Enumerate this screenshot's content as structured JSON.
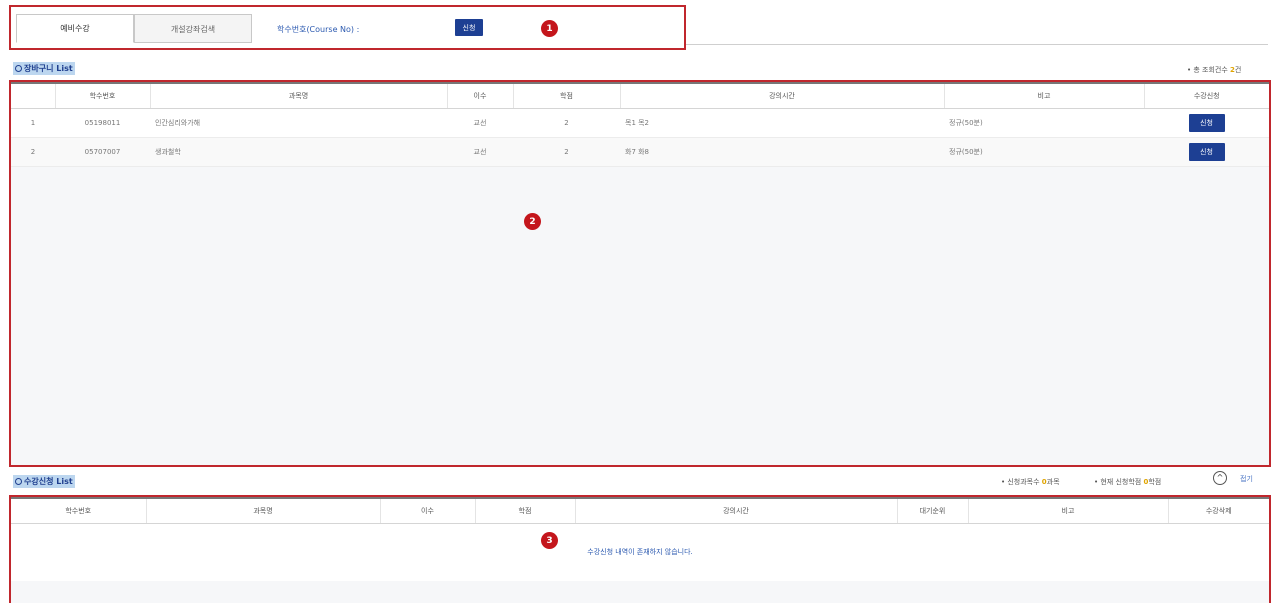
{
  "tabs": [
    {
      "label": "예비수강"
    },
    {
      "label": "개설강좌검색"
    }
  ],
  "search": {
    "course_no_label": "학수번호(Course No) :",
    "apply_button": "신청"
  },
  "markers": [
    "1",
    "2",
    "3"
  ],
  "cart": {
    "title": "장바구니 List",
    "count_prefix": "• 총 조회건수",
    "count_value": "2",
    "count_suffix": "건",
    "columns": [
      "학수번호",
      "과목명",
      "이수",
      "학점",
      "강의시간",
      "비고",
      "수강신청"
    ],
    "rows": [
      {
        "no": "1",
        "course_no": "05198011",
        "name": "인간심리와가해",
        "type": "교선",
        "credit": "2",
        "time": "목1 목2",
        "note": "정규(50분)",
        "action": "신청"
      },
      {
        "no": "2",
        "course_no": "05707007",
        "name": "생과철학",
        "type": "교선",
        "credit": "2",
        "time": "화7 화8",
        "note": "정규(50분)",
        "action": "신청"
      }
    ]
  },
  "application": {
    "title": "수강신청 List",
    "summary1_prefix": "• 신청과목수",
    "summary1_value": "0",
    "summary1_suffix": "과목",
    "summary2_prefix": "• 현재 신청학점",
    "summary2_value": "0",
    "summary2_suffix": "학점",
    "collapse_label": "접기",
    "columns": [
      "학수번호",
      "과목명",
      "이수",
      "학점",
      "강의시간",
      "대기순위",
      "비고",
      "수강삭제"
    ],
    "empty_message": "수강신청 내역이 존재하지 않습니다."
  },
  "colors": {
    "accent_red": "#c0272d",
    "button_blue": "#1d3f93",
    "highlight_yellow": "#e0a400"
  }
}
